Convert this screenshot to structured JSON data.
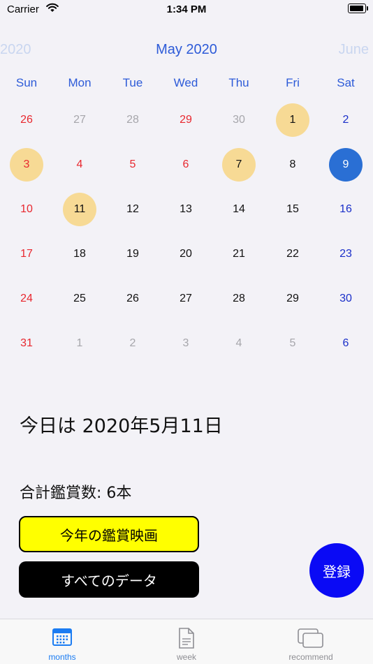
{
  "status_bar": {
    "carrier": "Carrier",
    "time": "1:34 PM"
  },
  "calendar": {
    "prev_label": "2020",
    "current_label": "May 2020",
    "next_label": "June",
    "weekdays": [
      "Sun",
      "Mon",
      "Tue",
      "Wed",
      "Thu",
      "Fri",
      "Sat"
    ],
    "weeks": [
      [
        {
          "d": "26",
          "k": "sun"
        },
        {
          "d": "27",
          "k": "out"
        },
        {
          "d": "28",
          "k": "out"
        },
        {
          "d": "29",
          "k": "sun"
        },
        {
          "d": "30",
          "k": "out"
        },
        {
          "d": "1",
          "k": "wk",
          "m": true
        },
        {
          "d": "2",
          "k": "sat"
        }
      ],
      [
        {
          "d": "3",
          "k": "sun",
          "m": true
        },
        {
          "d": "4",
          "k": "sun"
        },
        {
          "d": "5",
          "k": "sun"
        },
        {
          "d": "6",
          "k": "sun"
        },
        {
          "d": "7",
          "k": "wk",
          "m": true
        },
        {
          "d": "8",
          "k": "wk"
        },
        {
          "d": "9",
          "k": "sat",
          "s": true
        }
      ],
      [
        {
          "d": "10",
          "k": "sun"
        },
        {
          "d": "11",
          "k": "wk",
          "m": true
        },
        {
          "d": "12",
          "k": "wk"
        },
        {
          "d": "13",
          "k": "wk"
        },
        {
          "d": "14",
          "k": "wk"
        },
        {
          "d": "15",
          "k": "wk"
        },
        {
          "d": "16",
          "k": "sat"
        }
      ],
      [
        {
          "d": "17",
          "k": "sun"
        },
        {
          "d": "18",
          "k": "wk"
        },
        {
          "d": "19",
          "k": "wk"
        },
        {
          "d": "20",
          "k": "wk"
        },
        {
          "d": "21",
          "k": "wk"
        },
        {
          "d": "22",
          "k": "wk"
        },
        {
          "d": "23",
          "k": "sat"
        }
      ],
      [
        {
          "d": "24",
          "k": "sun"
        },
        {
          "d": "25",
          "k": "wk"
        },
        {
          "d": "26",
          "k": "wk"
        },
        {
          "d": "27",
          "k": "wk"
        },
        {
          "d": "28",
          "k": "wk"
        },
        {
          "d": "29",
          "k": "wk"
        },
        {
          "d": "30",
          "k": "sat"
        }
      ],
      [
        {
          "d": "31",
          "k": "sun"
        },
        {
          "d": "1",
          "k": "out"
        },
        {
          "d": "2",
          "k": "out"
        },
        {
          "d": "3",
          "k": "out"
        },
        {
          "d": "4",
          "k": "out"
        },
        {
          "d": "5",
          "k": "out"
        },
        {
          "d": "6",
          "k": "sat"
        }
      ]
    ]
  },
  "today_text": "今日は 2020年5月11日",
  "total_text": "合計鑑賞数: 6本",
  "buttons": {
    "this_year": "今年の鑑賞映画",
    "all_data": "すべてのデータ",
    "register": "登録"
  },
  "tabs": [
    {
      "label": "months",
      "icon": "calendar-icon"
    },
    {
      "label": "week",
      "icon": "document-icon"
    },
    {
      "label": "recommend",
      "icon": "cards-icon"
    }
  ],
  "colors": {
    "accent": "#2D5BD8",
    "sunday_holiday": "#E8282F",
    "saturday": "#1A2FC9",
    "marked": "#F7DA95",
    "selected": "#2A6FD4",
    "register_button": "#0A0AF5",
    "tab_active": "#1B7CF2"
  }
}
